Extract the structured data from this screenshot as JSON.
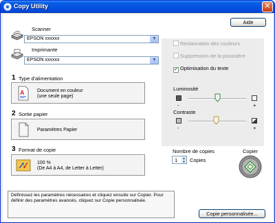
{
  "window": {
    "title": "Copy Utility",
    "close_symbol": "✕"
  },
  "buttons": {
    "help": "Aide",
    "custom_copy": "Copie personnalisée..."
  },
  "scanner": {
    "label": "Scanner",
    "value": "EPSON xxxxxx"
  },
  "printer": {
    "label": "Imprimante",
    "value": "EPSON xxxxxx"
  },
  "steps": [
    {
      "number": "1",
      "label": "Type d'alimentation",
      "lines": [
        "Document en couleur",
        "(une seule page)"
      ]
    },
    {
      "number": "2",
      "label": "Sortie papier",
      "lines": [
        "Paramètres Papier"
      ]
    },
    {
      "number": "3",
      "label": "Format de copie",
      "lines": [
        "100 %",
        "(De A4 à A4, de Letter à Letter)"
      ]
    }
  ],
  "options": {
    "color_restoration": {
      "label": "Restauration des couleurs",
      "checked": false,
      "enabled": false
    },
    "dust_removal": {
      "label": "Suppression de la poussière",
      "checked": false,
      "enabled": false
    },
    "text_enhancement": {
      "label": "Optimisation du texte",
      "checked": true,
      "enabled": true
    }
  },
  "brightness": {
    "label": "Luminosité",
    "minus": "-",
    "plus": "+"
  },
  "contrast": {
    "label": "Contraste",
    "minus": "-",
    "plus": "+"
  },
  "copies": {
    "label": "Nombre de copies",
    "value": "1",
    "unit": "Copies"
  },
  "copy": {
    "label": "Copier"
  },
  "note": {
    "text": "Définissez les paramètres nécessaires et cliquez ensuite sur Copier.  Pour définir des paramètres avancés, cliquez sur Copie personnalisée."
  }
}
